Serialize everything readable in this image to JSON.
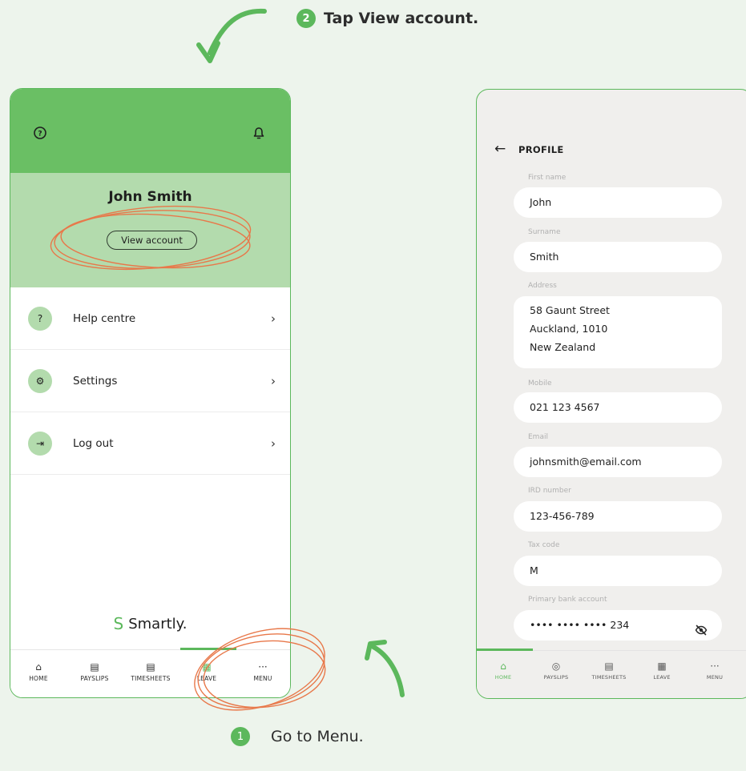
{
  "steps": {
    "step1": {
      "number": "1",
      "text": "Go to Menu."
    },
    "step2": {
      "number": "2",
      "text": "Tap View account."
    }
  },
  "left_screen": {
    "header": {
      "help_icon": "help-circle-icon",
      "bell_icon": "bell-icon"
    },
    "profile": {
      "name": "John Smith",
      "view_account_label": "View account"
    },
    "menu_items": [
      {
        "label": "Help centre",
        "icon": "help-circle-icon",
        "glyph": "?"
      },
      {
        "label": "Settings",
        "icon": "gear-icon",
        "glyph": "⚙"
      },
      {
        "label": "Log out",
        "icon": "logout-icon",
        "glyph": "⇥"
      }
    ],
    "brand": {
      "name": "Smartly.",
      "mark": "S"
    },
    "tabbar": [
      {
        "label": "HOME",
        "icon": "home-icon",
        "glyph": "⌂"
      },
      {
        "label": "PAYSLIPS",
        "icon": "payslips-icon",
        "glyph": "▤"
      },
      {
        "label": "TIMESHEETS",
        "icon": "timesheets-icon",
        "glyph": "▤"
      },
      {
        "label": "LEAVE",
        "icon": "calendar-icon",
        "glyph": "▦"
      },
      {
        "label": "MENU",
        "icon": "more-icon",
        "glyph": "···"
      }
    ]
  },
  "right_screen": {
    "title": "PROFILE",
    "back_icon": "back-arrow-icon",
    "fields": [
      {
        "label": "First name",
        "value": "John"
      },
      {
        "label": "Surname",
        "value": "Smith"
      },
      {
        "label": "Address",
        "lines": [
          "58 Gaunt Street",
          "Auckland, 1010",
          "New Zealand"
        ]
      },
      {
        "label": "Mobile",
        "value": "021 123 4567"
      },
      {
        "label": "Email",
        "value": "johnsmith@email.com"
      },
      {
        "label": "IRD number",
        "value": "123-456-789"
      },
      {
        "label": "Tax code",
        "value": "M"
      },
      {
        "label": "Primary bank account",
        "value": "•••• •••• •••• 234",
        "icon": "eye-off-icon"
      }
    ],
    "tabbar": [
      {
        "label": "HOME",
        "icon": "home-icon",
        "glyph": "⌂"
      },
      {
        "label": "PAYSLIPS",
        "icon": "payslips-icon",
        "glyph": "◎"
      },
      {
        "label": "TIMESHEETS",
        "icon": "timesheets-icon",
        "glyph": "▤"
      },
      {
        "label": "LEAVE",
        "icon": "calendar-icon",
        "glyph": "▦"
      },
      {
        "label": "MENU",
        "icon": "more-icon",
        "glyph": "···"
      }
    ]
  },
  "colors": {
    "background": "#edf4ec",
    "brand_green": "#5cb85c",
    "header_green": "#6abf64",
    "light_green": "#b3dbad",
    "annotation_orange": "#e8784a",
    "arrow_green": "#5cb85c"
  }
}
